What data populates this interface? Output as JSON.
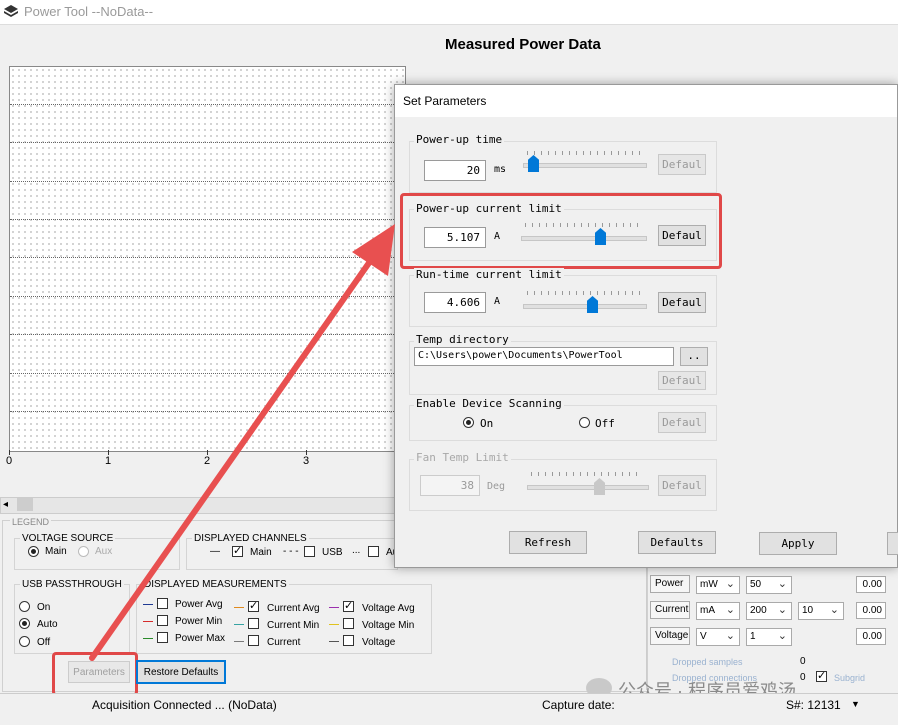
{
  "window": {
    "title": "Power Tool --NoData--",
    "icon": "app-chip-icon"
  },
  "chart": {
    "title": "Measured Power Data",
    "x_ticks": [
      "0",
      "1",
      "2",
      "3"
    ]
  },
  "chart_data": {
    "type": "line",
    "title": "Measured Power Data",
    "x_ticks": [
      0,
      1,
      2,
      3
    ],
    "series": [],
    "grid": "dotted"
  },
  "legend": {
    "label": "LEGEND",
    "voltage_source": {
      "title": "VOLTAGE SOURCE",
      "main": "Main",
      "aux": "Aux",
      "selected": "Main"
    },
    "displayed_channels": {
      "title": "DISPLAYED CHANNELS",
      "main_line": "—",
      "main": "Main",
      "usb_line": "- - -",
      "usb": "USB",
      "aux_line": "...",
      "aux": "Aux"
    },
    "usb_passthrough": {
      "title": "USB PASSTHROUGH",
      "options": [
        "On",
        "Auto",
        "Off"
      ],
      "selected": "Auto"
    },
    "displayed_measurements": {
      "title": "DISPLAYED MEASUREMENTS",
      "power_avg": "Power Avg",
      "power_min": "Power Min",
      "power_max": "Power Max",
      "current_avg": "Current Avg",
      "current_min": "Current Min",
      "current": "Current",
      "voltage_avg": "Voltage Avg",
      "voltage_min": "Voltage Min",
      "voltage": "Voltage"
    },
    "parameters_button": "Parameters",
    "restore_button": "Restore Defaults"
  },
  "units_panel": {
    "rows": [
      {
        "label": "Power",
        "unit": "mW",
        "value": "50",
        "box": "0.00"
      },
      {
        "label": "Current",
        "unit": "mA",
        "value": "200",
        "extra": "10",
        "box": "0.00"
      },
      {
        "label": "Voltage",
        "unit": "V",
        "value": "1",
        "box": "0.00"
      }
    ],
    "dropped_samples": "Dropped samples",
    "dropped_samples_value": "0",
    "dropped_connections": "Dropped connections",
    "dropped_connections_value": "0",
    "subgrid": "Subgrid"
  },
  "status": {
    "acquisition": "Acquisition Connected ... (NoData)",
    "capture_date": "Capture date:",
    "serial": "S#: 12131"
  },
  "dialog": {
    "title": "Set Parameters",
    "powerup_time": {
      "title": "Power-up time",
      "value": "20",
      "unit": "ms",
      "default": "Defaul"
    },
    "powerup_limit": {
      "title": "Power-up current limit",
      "value": "5.107",
      "unit": "A",
      "default": "Defaul"
    },
    "runtime_limit": {
      "title": "Run-time current limit",
      "value": "4.606",
      "unit": "A",
      "default": "Defaul"
    },
    "temp_dir": {
      "title": "Temp directory",
      "value": "C:\\Users\\power\\Documents\\PowerTool",
      "browse": "..",
      "default": "Defaul"
    },
    "scanning": {
      "title": "Enable Device Scanning",
      "on": "On",
      "off": "Off",
      "selected": "On",
      "default": "Defaul"
    },
    "fan_temp": {
      "title": "Fan Temp Limit",
      "value": "38",
      "unit": "Deg",
      "default": "Defaul"
    },
    "buttons": {
      "refresh": "Refresh",
      "defaults": "Defaults",
      "apply": "Apply"
    }
  },
  "watermark": "公众号 · 程序员爱鸡汤",
  "colors": {
    "accent": "#0078d7",
    "highlight": "#e04848"
  }
}
